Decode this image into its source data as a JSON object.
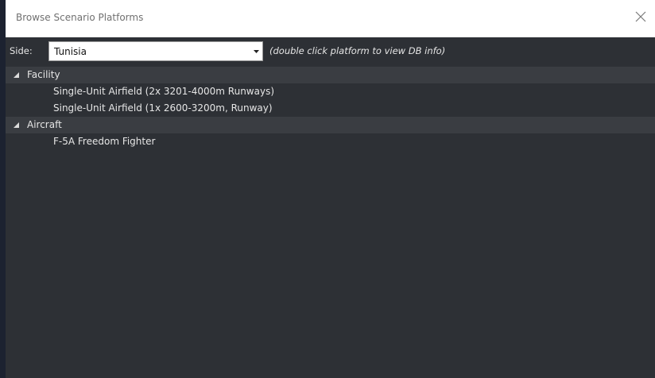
{
  "window": {
    "title": "Browse Scenario Platforms",
    "close_icon": "close-icon"
  },
  "side": {
    "label": "Side:",
    "selected": "Tunisia",
    "hint": "(double click platform to view DB info)"
  },
  "tree": {
    "groups": [
      {
        "label": "Facility",
        "expanded": true,
        "items": [
          {
            "label": "Single-Unit Airfield (2x 3201-4000m Runways)"
          },
          {
            "label": "Single-Unit Airfield (1x 2600-3200m, Runway)"
          }
        ]
      },
      {
        "label": "Aircraft",
        "expanded": true,
        "items": [
          {
            "label": "F-5A Freedom Fighter"
          }
        ]
      }
    ]
  },
  "colors": {
    "panel_bg": "#2d3035",
    "group_row_bg": "#3a3d42",
    "text": "#e6e6e6",
    "titlebar_bg": "#ffffff"
  }
}
